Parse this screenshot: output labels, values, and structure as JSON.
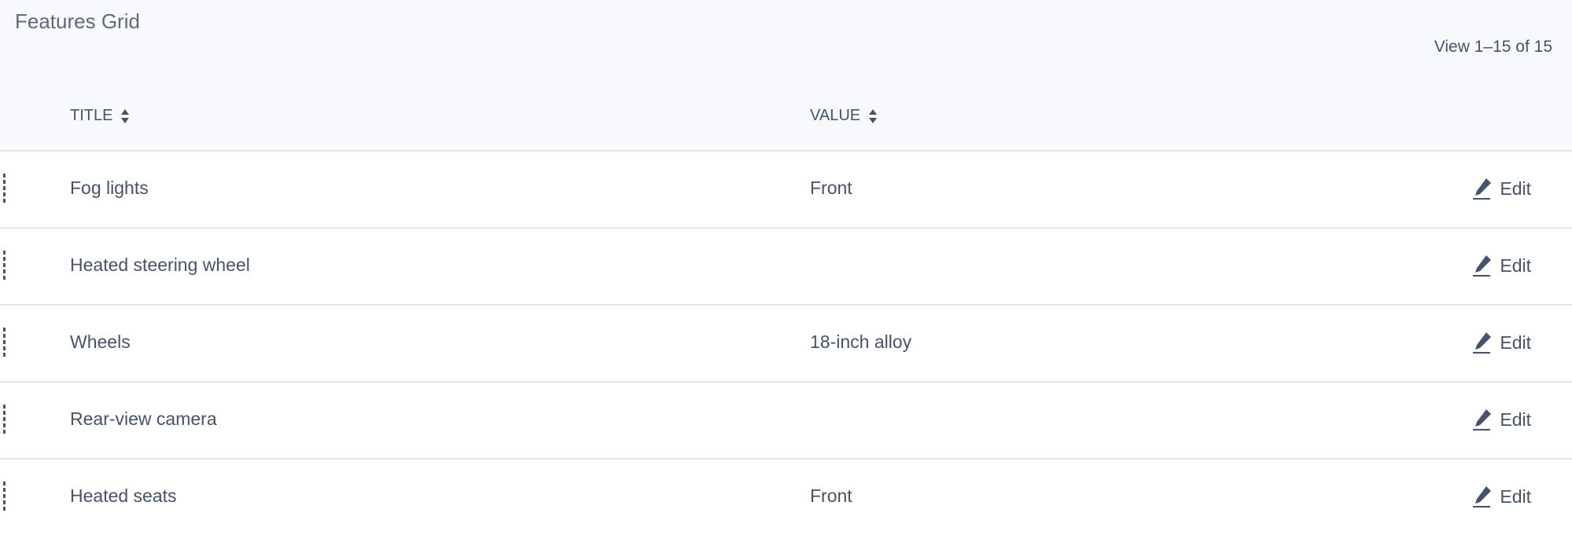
{
  "header": {
    "title": "Features Grid",
    "pagination": "View 1–15 of 15"
  },
  "columns": {
    "title": {
      "label": "TITLE",
      "sort_icon": "sort-icon"
    },
    "value": {
      "label": "VALUE",
      "sort_icon": "sort-icon"
    }
  },
  "rows": [
    {
      "title": "Fog lights",
      "value": "Front",
      "action": "Edit"
    },
    {
      "title": "Heated steering wheel",
      "value": "",
      "action": "Edit"
    },
    {
      "title": "Wheels",
      "value": "18-inch alloy",
      "action": "Edit"
    },
    {
      "title": "Rear-view camera",
      "value": "",
      "action": "Edit"
    },
    {
      "title": "Heated seats",
      "value": "Front",
      "action": "Edit"
    }
  ],
  "icons": {
    "drag_handle": "drag-handle-icon",
    "edit": "pencil-icon"
  },
  "colors": {
    "text": "#45536b",
    "header_bg": "#f8f9fc",
    "divider": "#e3e6ec"
  }
}
